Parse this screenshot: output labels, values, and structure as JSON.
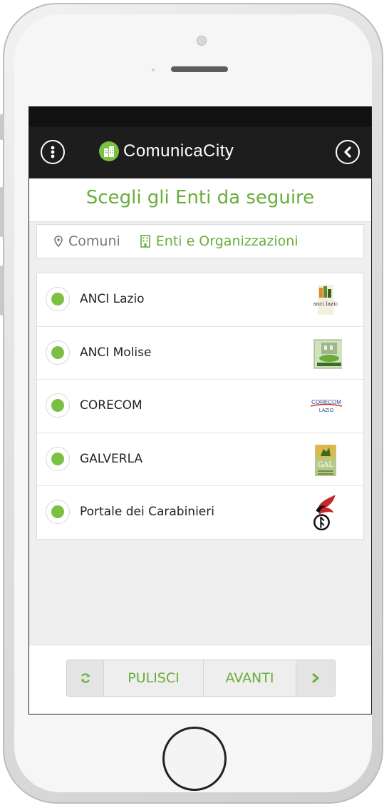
{
  "app": {
    "name": "ComunicaCity",
    "page_title": "Scegli gli Enti da seguire"
  },
  "tabs": [
    {
      "label": "Comuni",
      "icon": "map-marker-icon",
      "active": false
    },
    {
      "label": "Enti e Organizzazioni",
      "icon": "building-icon",
      "active": true
    }
  ],
  "entities": [
    {
      "label": "ANCI Lazio",
      "logo": "anci-lazio-logo",
      "selected": true
    },
    {
      "label": "ANCI Molise",
      "logo": "anci-molise-logo",
      "selected": true
    },
    {
      "label": "CORECOM",
      "logo": "corecom-logo",
      "selected": true
    },
    {
      "label": "GALVERLA",
      "logo": "galverla-logo",
      "selected": true
    },
    {
      "label": "Portale dei Carabinieri",
      "logo": "carabinieri-logo",
      "selected": true
    }
  ],
  "actions": {
    "clear_label": "PULISCI",
    "next_label": "AVANTI"
  },
  "logo_text": {
    "anci_lazio": "anci lazio",
    "corecom_top": "CORECOM",
    "corecom_bottom": "LAZIO",
    "galverla": "GAL"
  },
  "colors": {
    "accent": "#6aad3a",
    "radio": "#7bc043",
    "appbar": "#1d1d1d"
  }
}
